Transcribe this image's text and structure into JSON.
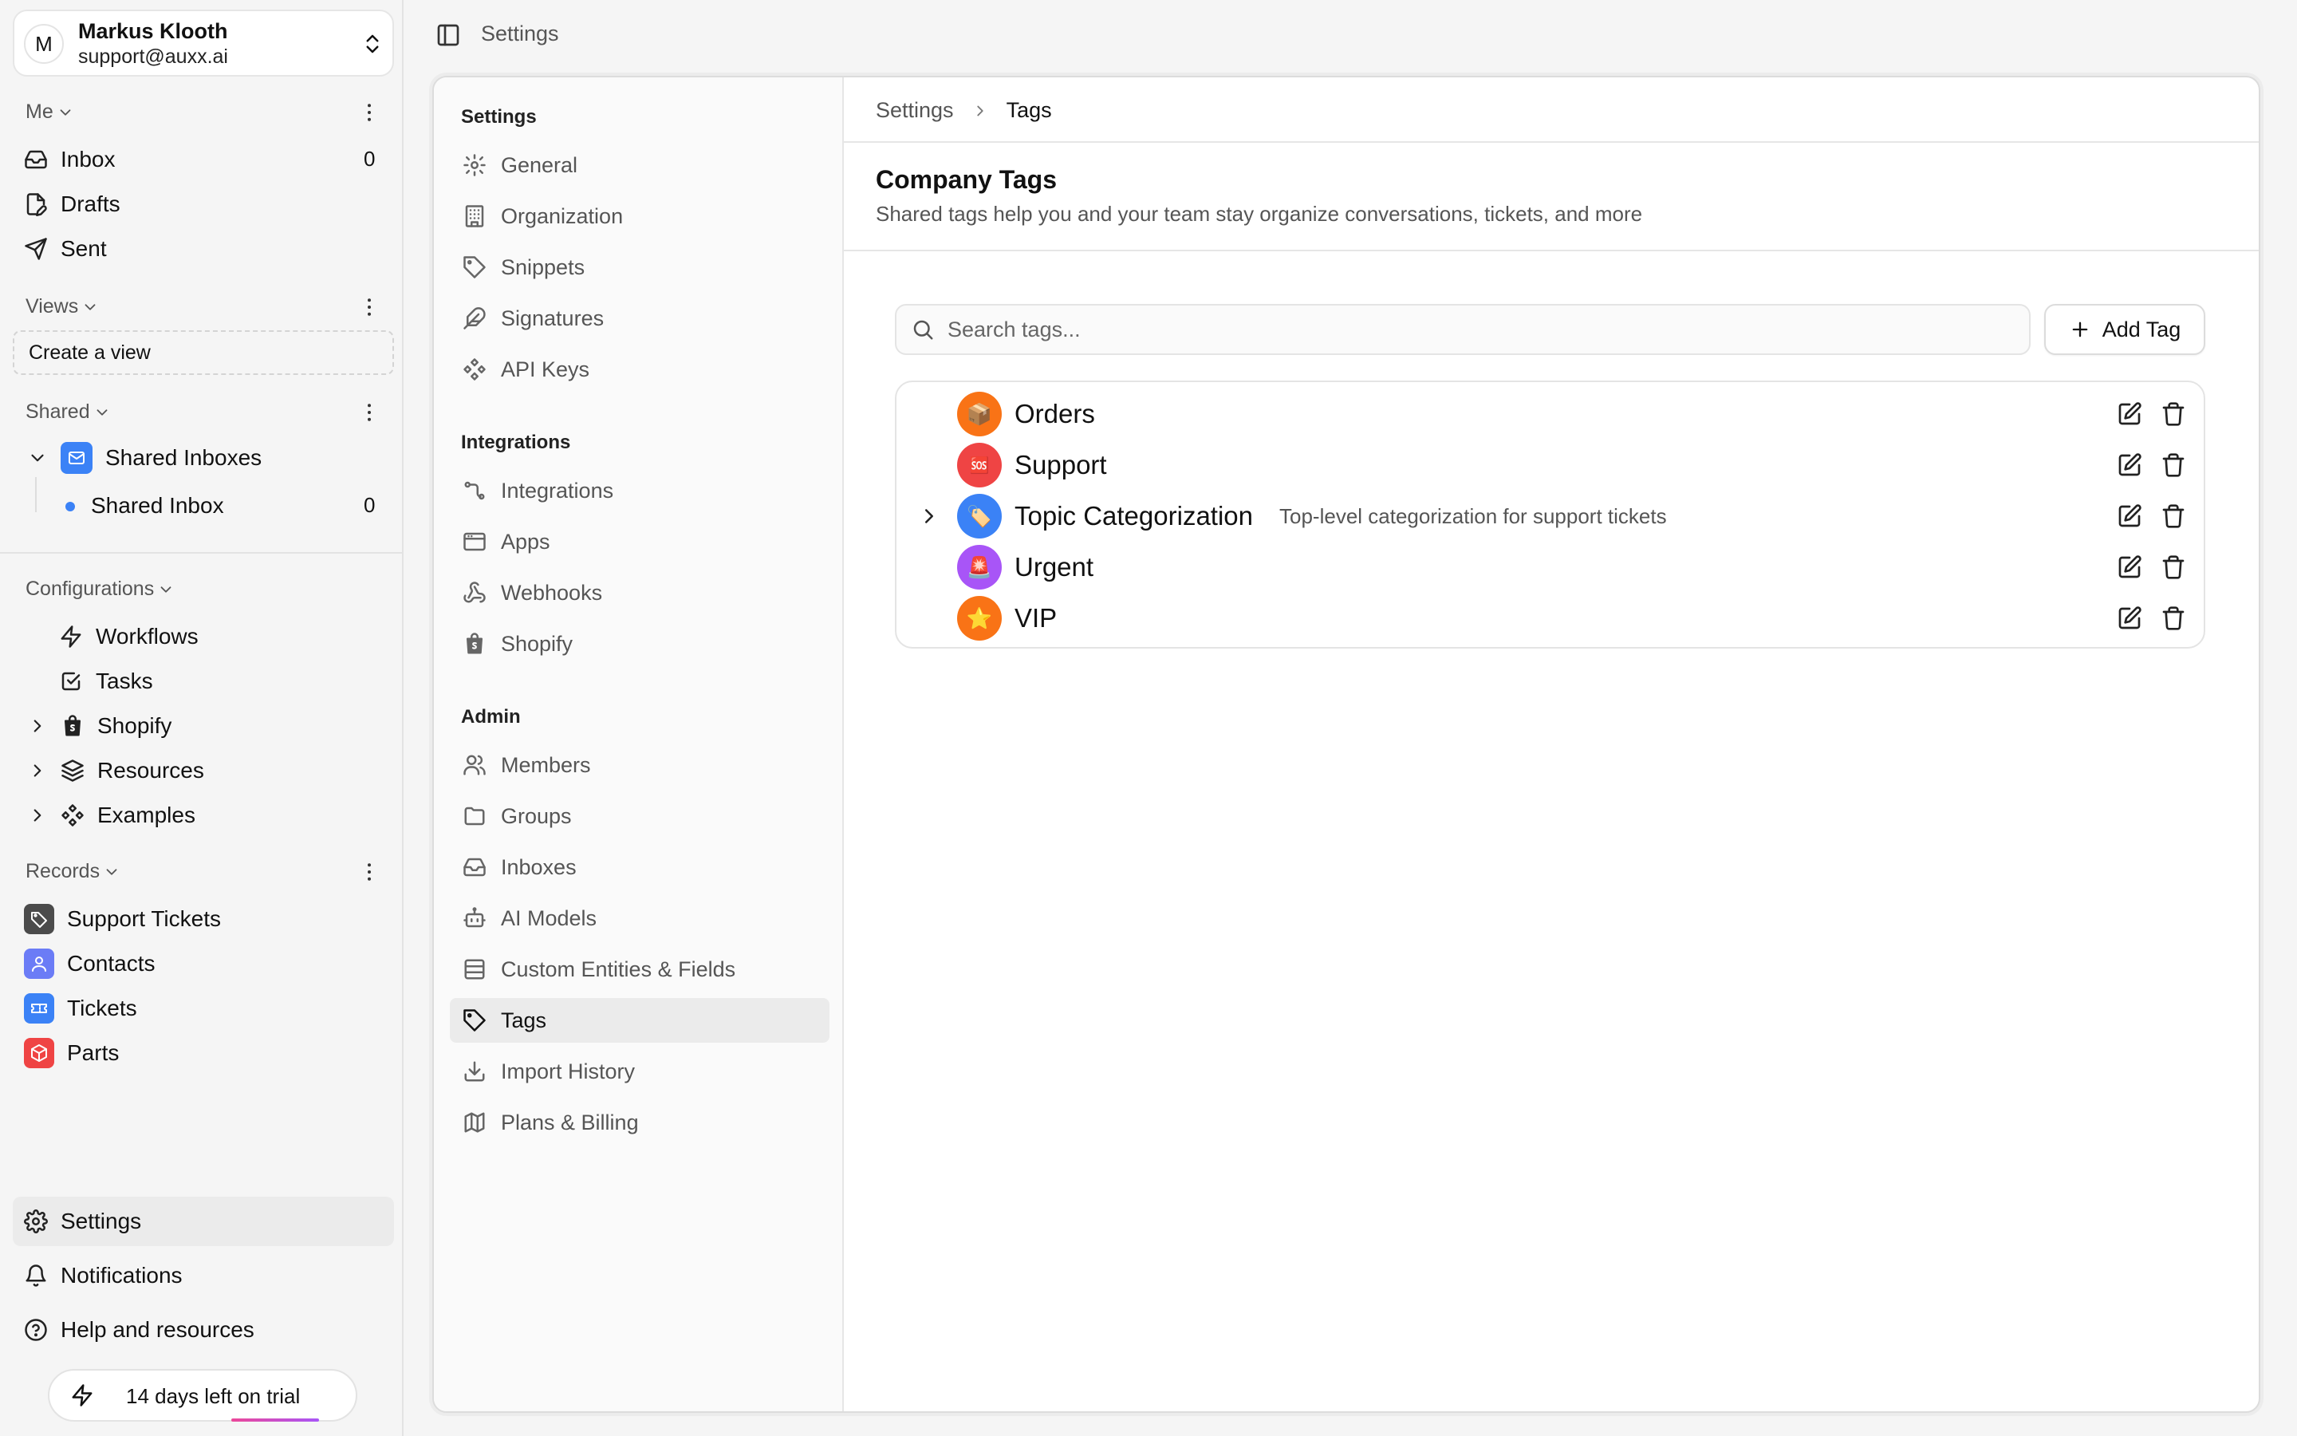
{
  "user": {
    "initial": "M",
    "name": "Markus Klooth",
    "email": "support@auxx.ai"
  },
  "sidebar": {
    "me": {
      "heading": "Me",
      "items": [
        {
          "label": "Inbox",
          "count": "0"
        },
        {
          "label": "Drafts"
        },
        {
          "label": "Sent"
        }
      ]
    },
    "views": {
      "heading": "Views",
      "create_label": "Create a view"
    },
    "shared": {
      "heading": "Shared",
      "group_label": "Shared Inboxes",
      "inbox_label": "Shared Inbox",
      "inbox_count": "0"
    },
    "configurations": {
      "heading": "Configurations",
      "items": [
        {
          "label": "Workflows"
        },
        {
          "label": "Tasks"
        },
        {
          "label": "Shopify"
        },
        {
          "label": "Resources"
        },
        {
          "label": "Examples"
        }
      ]
    },
    "records": {
      "heading": "Records",
      "items": [
        {
          "label": "Support Tickets",
          "color": "#4b4b4b"
        },
        {
          "label": "Contacts",
          "color": "#6b7cf6"
        },
        {
          "label": "Tickets",
          "color": "#3b82f6"
        },
        {
          "label": "Parts",
          "color": "#ef4444"
        }
      ]
    },
    "bottom": {
      "settings": "Settings",
      "notifications": "Notifications",
      "help": "Help and resources"
    },
    "trial": "14 days left on trial"
  },
  "topbar": {
    "title": "Settings"
  },
  "subnav": {
    "settings_heading": "Settings",
    "settings_items": [
      "General",
      "Organization",
      "Snippets",
      "Signatures",
      "API Keys"
    ],
    "integrations_heading": "Integrations",
    "integrations_items": [
      "Integrations",
      "Apps",
      "Webhooks",
      "Shopify"
    ],
    "admin_heading": "Admin",
    "admin_items": [
      "Members",
      "Groups",
      "Inboxes",
      "AI Models",
      "Custom Entities & Fields",
      "Tags",
      "Import History",
      "Plans & Billing"
    ],
    "active": "Tags"
  },
  "content": {
    "breadcrumb": [
      "Settings",
      "Tags"
    ],
    "title": "Company Tags",
    "subtitle": "Shared tags help you and your team stay organize conversations, tickets, and more",
    "search_placeholder": "Search tags...",
    "add_label": "Add Tag",
    "tags": [
      {
        "name": "Orders",
        "emoji": "📦",
        "color": "#f97316",
        "description": ""
      },
      {
        "name": "Support",
        "emoji": "🆘",
        "color": "#ef4444",
        "description": ""
      },
      {
        "name": "Topic Categorization",
        "emoji": "🏷️",
        "color": "#3b82f6",
        "description": "Top-level categorization for support tickets",
        "expandable": true
      },
      {
        "name": "Urgent",
        "emoji": "🚨",
        "color": "#a855f7",
        "description": ""
      },
      {
        "name": "VIP",
        "emoji": "⭐",
        "color": "#f97316",
        "description": ""
      }
    ]
  }
}
